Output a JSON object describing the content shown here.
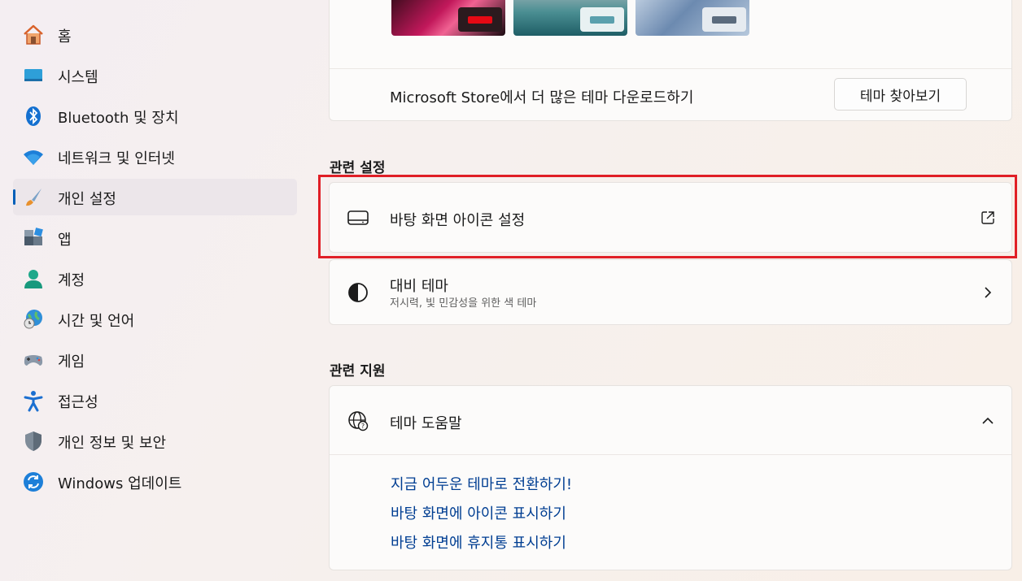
{
  "sidebar": {
    "items": [
      {
        "label": "홈",
        "icon": "home-icon"
      },
      {
        "label": "시스템",
        "icon": "system-icon"
      },
      {
        "label": "Bluetooth 및 장치",
        "icon": "bluetooth-icon"
      },
      {
        "label": "네트워크 및 인터넷",
        "icon": "wifi-icon"
      },
      {
        "label": "개인 설정",
        "icon": "brush-icon",
        "active": true
      },
      {
        "label": "앱",
        "icon": "apps-icon"
      },
      {
        "label": "계정",
        "icon": "account-icon"
      },
      {
        "label": "시간 및 언어",
        "icon": "time-language-icon"
      },
      {
        "label": "게임",
        "icon": "gamepad-icon"
      },
      {
        "label": "접근성",
        "icon": "accessibility-icon"
      },
      {
        "label": "개인 정보 및 보안",
        "icon": "shield-icon"
      },
      {
        "label": "Windows 업데이트",
        "icon": "update-icon"
      }
    ],
    "accent": "#005fb8"
  },
  "themes": {
    "store_text": "Microsoft Store에서 더 많은 테마 다운로드하기",
    "browse_button": "테마 찾아보기"
  },
  "related_settings": {
    "title": "관련 설정",
    "desktop_icons": {
      "label": "바탕 화면 아이콘 설정",
      "icon": "monitor-icon",
      "action_icon": "open-external-icon"
    },
    "contrast": {
      "label": "대비 테마",
      "sub": "저시력, 빛 민감성을 위한 색 테마",
      "icon": "contrast-icon",
      "action_icon": "chevron-right-icon"
    }
  },
  "related_support": {
    "title": "관련 지원",
    "help": {
      "label": "테마 도움말",
      "icon": "globe-help-icon",
      "action_icon": "chevron-up-icon"
    },
    "links": [
      "지금 어두운 테마로 전환하기!",
      "바탕 화면에 아이콘 표시하기",
      "바탕 화면에 휴지통 표시하기"
    ]
  },
  "colors": {
    "link": "#003e92",
    "highlight": "#e01f26"
  }
}
